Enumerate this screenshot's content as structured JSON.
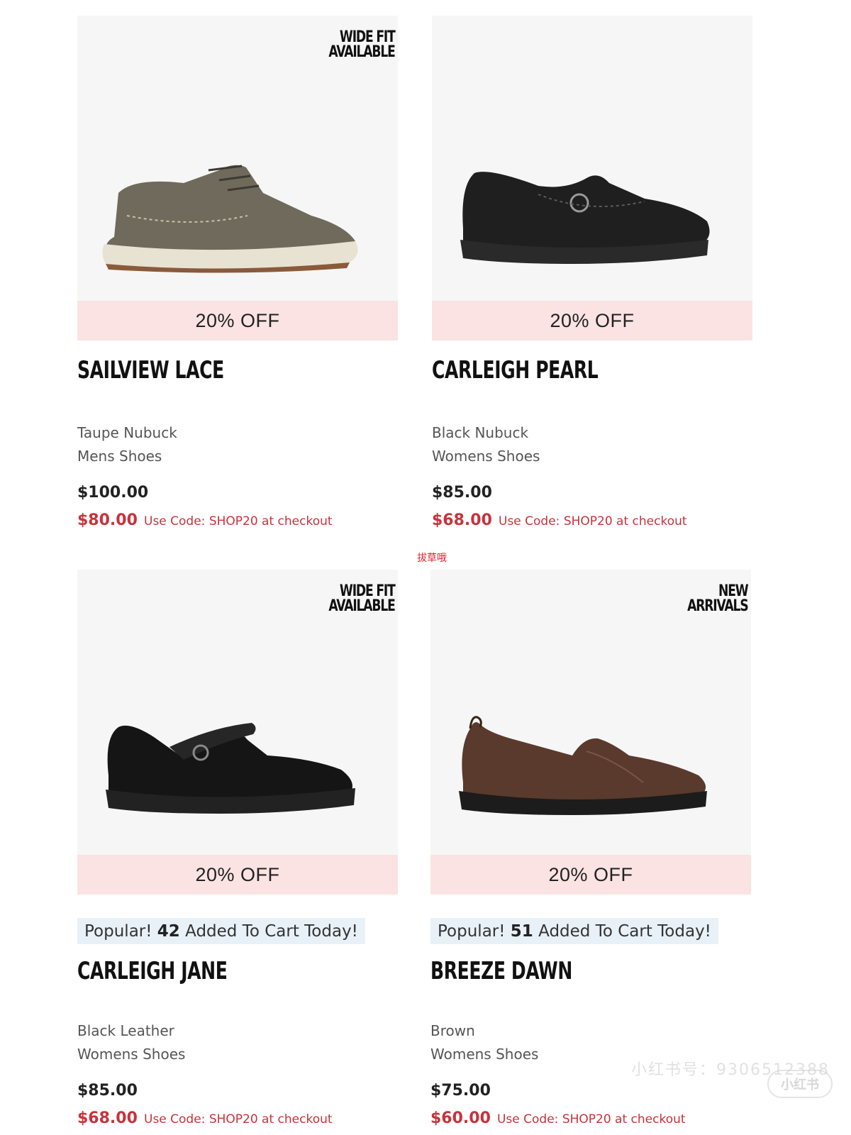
{
  "products": [
    {
      "tag": [
        "WIDE FIT",
        "AVAILABLE"
      ],
      "discount": "20% OFF",
      "popular": null,
      "name": "SAILVIEW LACE",
      "color": "Taupe Nubuck",
      "category": "Mens Shoes",
      "price": "$100.00",
      "sale_price": "$80.00",
      "code_text": "Use Code: SHOP20 at checkout",
      "shoe_color": "#6f6a5b"
    },
    {
      "tag": [],
      "discount": "20% OFF",
      "popular": null,
      "name": "CARLEIGH PEARL",
      "color": "Black Nubuck",
      "category": "Womens Shoes",
      "price": "$85.00",
      "sale_price": "$68.00",
      "code_text": "Use Code: SHOP20 at checkout",
      "shoe_color": "#1f1f1f"
    },
    {
      "tag": [
        "WIDE FIT",
        "AVAILABLE"
      ],
      "discount": "20% OFF",
      "popular": {
        "prefix": "Popular!",
        "count": "42",
        "suffix": "Added To Cart Today!"
      },
      "name": "CARLEIGH JANE",
      "color": "Black Leather",
      "category": "Womens Shoes",
      "price": "$85.00",
      "sale_price": "$68.00",
      "code_text": "Use Code: SHOP20 at checkout",
      "shoe_color": "#151515"
    },
    {
      "tag": [
        "NEW",
        "ARRIVALS"
      ],
      "discount": "20% OFF",
      "popular": {
        "prefix": "Popular!",
        "count": "51",
        "suffix": "Added To Cart Today!"
      },
      "name": "BREEZE DAWN",
      "color": "Brown",
      "category": "Womens Shoes",
      "price": "$75.00",
      "sale_price": "$60.00",
      "code_text": "Use Code: SHOP20 at checkout",
      "shoe_color": "#5a3a2c"
    }
  ],
  "watermarks": {
    "center_red": "拔草哦",
    "bottom_grey": "小红书号：9306512388",
    "logo": "小红书"
  }
}
